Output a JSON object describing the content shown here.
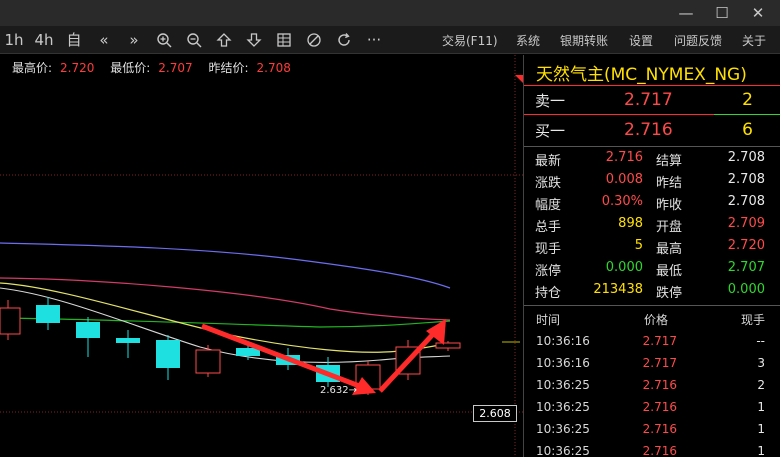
{
  "window": {
    "minimize": "—",
    "maximize": "☐",
    "close": "✕"
  },
  "toolbar": {
    "icons": [
      {
        "name": "period-1h",
        "label": "1h"
      },
      {
        "name": "period-4h",
        "label": "4h"
      },
      {
        "name": "custom",
        "label": "自"
      },
      {
        "name": "prev",
        "label": "«"
      },
      {
        "name": "next",
        "label": "»"
      }
    ],
    "more_label": "···",
    "menu": [
      "交易(F11)",
      "系统",
      "银期转账",
      "设置",
      "问题反馈",
      "关于"
    ]
  },
  "chart_info": {
    "high_label": "最高价:",
    "high": "2.720",
    "low_label": "最低价:",
    "low": "2.707",
    "prev_label": "昨结价:",
    "prev": "2.708"
  },
  "chart": {
    "low_marker": "2.632",
    "price_tag": "2.608"
  },
  "quote": {
    "title": "天然气主(MC_NYMEX_NG)",
    "sell": {
      "label": "卖一",
      "price": "2.717",
      "volume": "2"
    },
    "buy": {
      "label": "买一",
      "price": "2.716",
      "volume": "6"
    },
    "rows": [
      {
        "l1": "最新",
        "v1": "2.716",
        "c1": "#ff4a4a",
        "l2": "结算",
        "v2": "2.708",
        "c2": "#e8e8e8"
      },
      {
        "l1": "涨跌",
        "v1": "0.008",
        "c1": "#ff4a4a",
        "l2": "昨结",
        "v2": "2.708",
        "c2": "#e8e8e8"
      },
      {
        "l1": "幅度",
        "v1": "0.30%",
        "c1": "#ff4a4a",
        "l2": "昨收",
        "v2": "2.708",
        "c2": "#e8e8e8"
      },
      {
        "l1": "总手",
        "v1": "898",
        "c1": "#ffe000",
        "l2": "开盘",
        "v2": "2.709",
        "c2": "#ff4a4a"
      },
      {
        "l1": "现手",
        "v1": "5",
        "c1": "#ffe000",
        "l2": "最高",
        "v2": "2.720",
        "c2": "#ff4a4a"
      },
      {
        "l1": "涨停",
        "v1": "0.000",
        "c1": "#2ed82e",
        "l2": "最低",
        "v2": "2.707",
        "c2": "#2ed82e"
      },
      {
        "l1": "持仓",
        "v1": "213438",
        "c1": "#ffe000",
        "l2": "跌停",
        "v2": "0.000",
        "c2": "#2ed82e"
      }
    ]
  },
  "trades": {
    "headers": [
      "时间",
      "价格",
      "现手"
    ],
    "rows": [
      {
        "time": "10:36:16",
        "price": "2.717",
        "vol": "--"
      },
      {
        "time": "10:36:16",
        "price": "2.717",
        "vol": "3"
      },
      {
        "time": "10:36:25",
        "price": "2.716",
        "vol": "2"
      },
      {
        "time": "10:36:25",
        "price": "2.716",
        "vol": "1"
      },
      {
        "time": "10:36:25",
        "price": "2.716",
        "vol": "1"
      },
      {
        "time": "10:36:25",
        "price": "2.716",
        "vol": "1"
      }
    ]
  }
}
